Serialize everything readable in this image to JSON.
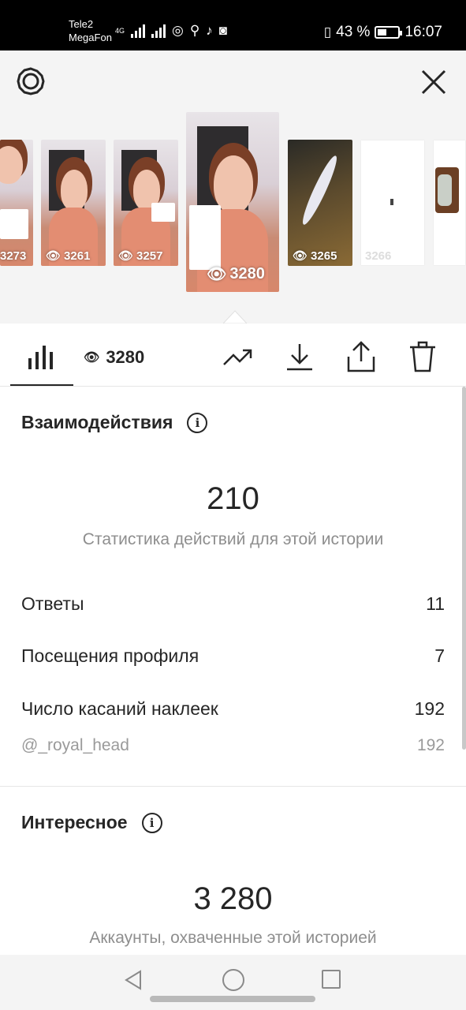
{
  "status_bar": {
    "carrier1": "Tele2",
    "carrier2": "MegaFon",
    "network": "4G",
    "battery": "43 %",
    "battery_fraction": 0.43,
    "time": "16:07"
  },
  "stories": [
    {
      "views": "3273"
    },
    {
      "views": "3261"
    },
    {
      "views": "3257"
    },
    {
      "views": "3280"
    },
    {
      "views": "3265"
    },
    {
      "views": "3266"
    }
  ],
  "tabs": {
    "views_count": "3280"
  },
  "interactions": {
    "title": "Взаимодействия",
    "total": "210",
    "caption": "Статистика действий для этой истории",
    "rows": [
      {
        "label": "Ответы",
        "value": "11"
      },
      {
        "label": "Посещения профиля",
        "value": "7"
      },
      {
        "label": "Число касаний наклеек",
        "value": "192"
      }
    ],
    "sub_row": {
      "label": "@_royal_head",
      "value": "192"
    }
  },
  "discovery": {
    "title": "Интересное",
    "total": "3 280",
    "caption": "Аккаунты, охваченные этой историей"
  },
  "icons": {
    "settings": "gear-icon",
    "close": "close-icon",
    "insights": "bar-chart-icon",
    "views": "eye-icon",
    "promote": "trend-icon",
    "download": "download-icon",
    "share": "share-icon",
    "delete": "trash-icon"
  }
}
